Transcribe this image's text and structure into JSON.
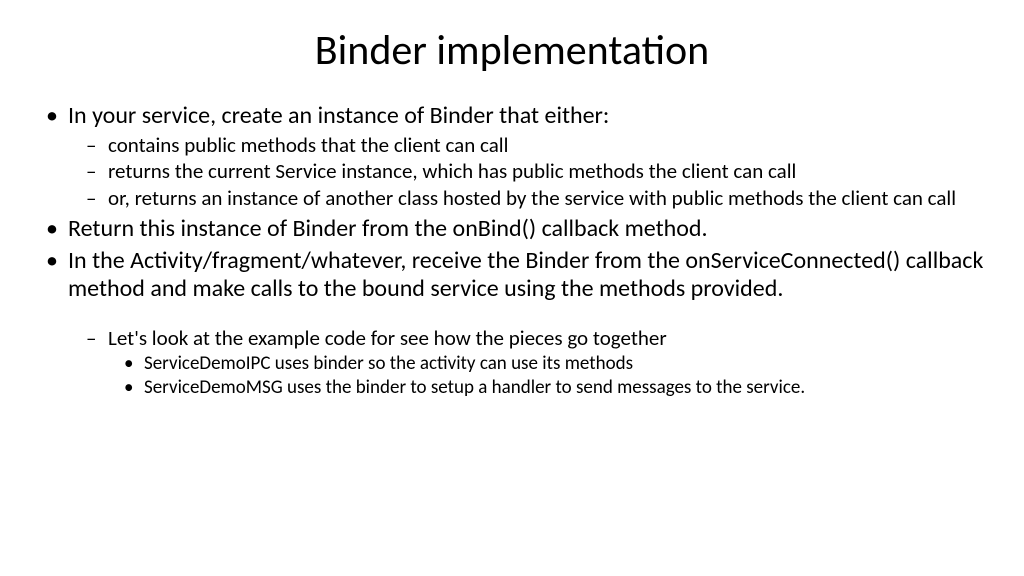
{
  "title": "Binder implementation",
  "bullets": {
    "b1": "In your service, create an instance of Binder that either:",
    "b1a": "contains public methods that the client can call",
    "b1b": "returns the current Service instance, which has public methods the client can call",
    "b1c": "or, returns an instance of another class hosted by the service with public methods the client can call",
    "b2": "Return this instance of Binder from the onBind() callback method.",
    "b3": "In the Activity/fragment/whatever, receive the Binder from the onServiceConnected() callback method and make calls to the bound service using the methods provided.",
    "b4a": "Let's look at the example code for see how the pieces go together",
    "b4a1": "ServiceDemoIPC  uses  binder so the activity can use its methods",
    "b4a2": "ServiceDemoMSG uses the binder to setup a handler to send messages to the service."
  }
}
